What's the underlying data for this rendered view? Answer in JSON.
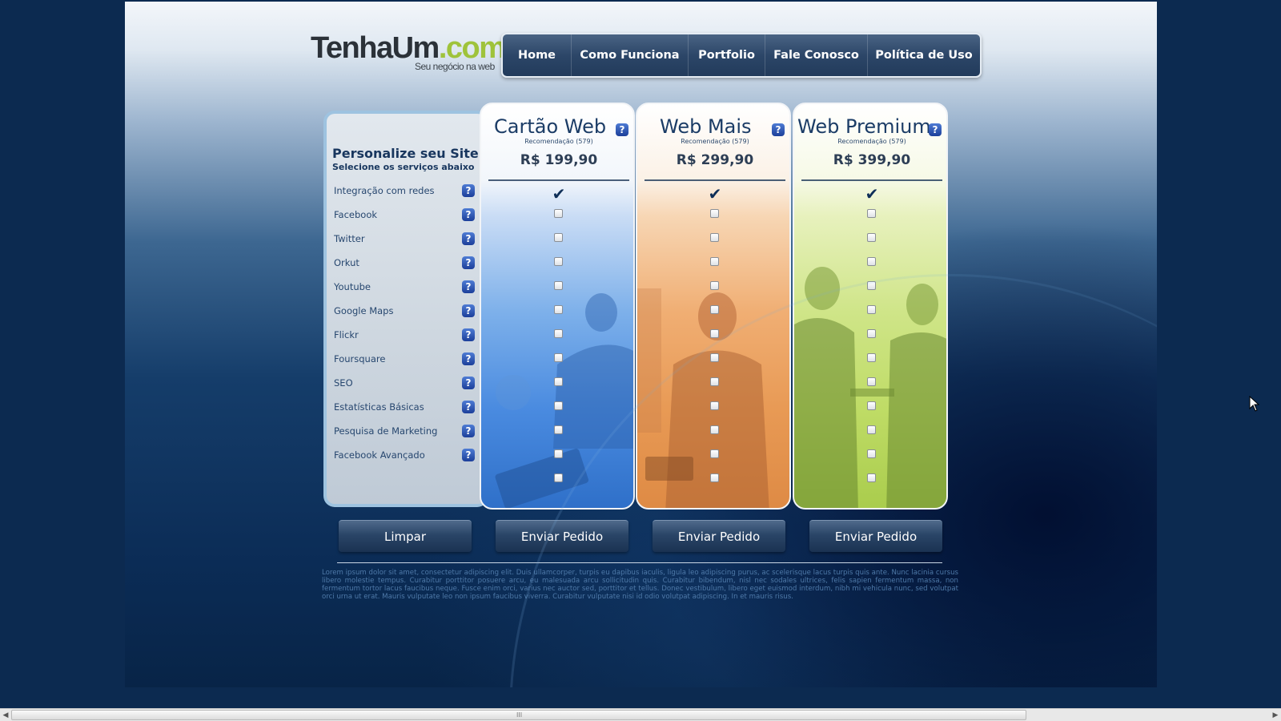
{
  "logo": {
    "part1": "TenhaUm",
    "part2": ".com",
    "tagline": "Seu negócio na web"
  },
  "nav": {
    "items": [
      "Home",
      "Como Funciona",
      "Portfolio",
      "Fale Conosco",
      "Política de Uso"
    ]
  },
  "features": {
    "title": "Personalize seu Site",
    "subtitle": "Selecione os serviços abaixo",
    "items": [
      "Integração com redes",
      "Facebook",
      "Twitter",
      "Orkut",
      "Youtube",
      "Google Maps",
      "Flickr",
      "Foursquare",
      "SEO",
      "Estatísticas Básicas",
      "Pesquisa de Marketing",
      "Facebook Avançado"
    ]
  },
  "plans": [
    {
      "name": "Cartão Web",
      "recommendation": "Recomendação (579)",
      "price": "R$ 199,90"
    },
    {
      "name": "Web Mais",
      "recommendation": "Recomendação (579)",
      "price": "R$ 299,90"
    },
    {
      "name": "Web Premium",
      "recommendation": "Recomendação (579)",
      "price": "R$ 399,90"
    }
  ],
  "icons": {
    "help": "?",
    "check": "✔"
  },
  "buttons": {
    "clear": "Limpar",
    "send": "Enviar Pedido"
  },
  "footer": {
    "lorem": "Lorem ipsum dolor sit amet, consectetur adipiscing elit. Duis ullamcorper, turpis eu dapibus iaculis, ligula leo adipiscing purus, ac scelerisque lacus turpis quis ante. Nunc lacinia cursus libero molestie tempus. Curabitur porttitor posuere arcu, eu malesuada arcu sollicitudin quis. Curabitur bibendum, nisl nec sodales ultrices, felis sapien fermentum massa, non fermentum tortor lacus faucibus neque. Fusce enim orci, varius nec auctor sed, porttitor et tellus. Donec vestibulum, libero eget euismod interdum, nibh mi vehicula nunc, sed volutpat orci urna ut erat. Mauris vulputate leo non ipsum faucibus viverra. Curabitur vulputate nisi id odio volutpat adipiscing. In et mauris risus."
  },
  "colors": {
    "accent_green": "#9fc33b",
    "nav_bg": "#2c4668",
    "plan_blue": "#4a8be0",
    "plan_orange": "#e89a55",
    "plan_green": "#bfdc66"
  },
  "scrollbar": {
    "grip": "III"
  }
}
